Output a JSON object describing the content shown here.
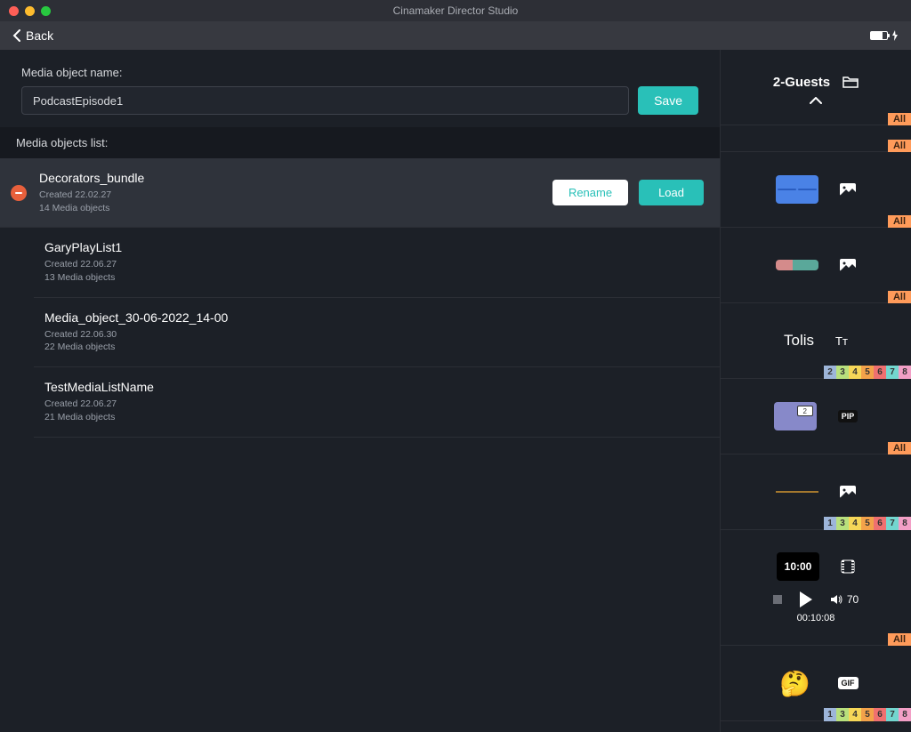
{
  "window": {
    "title": "Cinamaker Director Studio"
  },
  "toolbar": {
    "back_label": "Back"
  },
  "form": {
    "label": "Media object name:",
    "value": "PodcastEpisode1",
    "save_label": "Save"
  },
  "list": {
    "header": "Media objects list:",
    "actions": {
      "rename": "Rename",
      "load": "Load"
    },
    "items": [
      {
        "name": "Decorators_bundle",
        "created": "Created 22.02.27",
        "count": "14 Media objects",
        "selected": true
      },
      {
        "name": "GaryPlayList1",
        "created": "Created 22.06.27",
        "count": "13 Media objects",
        "selected": false
      },
      {
        "name": "Media_object_30-06-2022_14-00",
        "created": "Created 22.06.30",
        "count": "22 Media objects",
        "selected": false
      },
      {
        "name": "TestMediaListName",
        "created": "Created 22.06.27",
        "count": "21 Media objects",
        "selected": false
      }
    ]
  },
  "sidebar": {
    "title": "2-Guests",
    "badge_all": "All",
    "panels": {
      "tolis_label": "Tolis",
      "pip_label": "PIP",
      "gif_label": "GIF",
      "clock_value": "10:00",
      "timecode": "00:10:08",
      "volume": "70",
      "purple_badge": "2",
      "text_icon": "Tᴛ"
    },
    "numbers_a": [
      "2",
      "3",
      "4",
      "5",
      "6",
      "7",
      "8"
    ],
    "numbers_b": [
      "1",
      "3",
      "4",
      "5",
      "6",
      "7",
      "8"
    ],
    "numbers_c": [
      "1",
      "3",
      "4",
      "5",
      "6",
      "7",
      "8"
    ],
    "num_colors": [
      "#9db5d9",
      "#b8e07d",
      "#f6d758",
      "#f3a24a",
      "#ef7070",
      "#73d6cf",
      "#f29fc6"
    ]
  }
}
